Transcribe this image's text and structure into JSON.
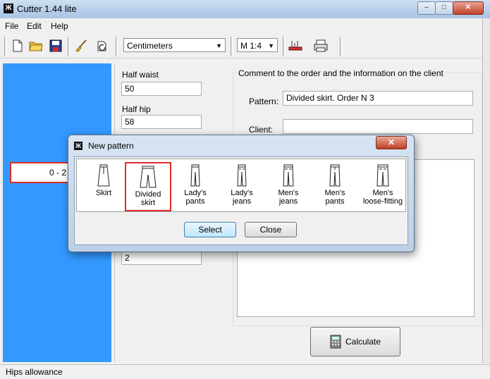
{
  "window": {
    "title": "Cutter 1.44 lite",
    "min": "–",
    "max": "□",
    "close": "✕"
  },
  "menu": [
    "File",
    "Edit",
    "Help"
  ],
  "toolbar": {
    "units": "Centimeters",
    "scale": "M 1:4"
  },
  "left_list": {
    "selected": "0 - 2"
  },
  "measurements": [
    {
      "label": "Half waist",
      "value": "50"
    },
    {
      "label": "Half hip",
      "value": "58"
    }
  ],
  "hidden_field_value": "2",
  "comment": {
    "legend": "Comment to the order and the information on the client",
    "pattern_label": "Pattern:",
    "pattern_value": "Divided skirt. Order N 3",
    "client_label": "Client:",
    "client_value": ""
  },
  "calculate_label": "Calculate",
  "status": "Hips allowance",
  "dialog": {
    "title": "New pattern",
    "close": "✕",
    "patterns": [
      {
        "line1": "Skirt",
        "line2": ""
      },
      {
        "line1": "Divided",
        "line2": "skirt"
      },
      {
        "line1": "Lady's",
        "line2": "pants"
      },
      {
        "line1": "Lady's",
        "line2": "jeans"
      },
      {
        "line1": "Men's",
        "line2": "jeans"
      },
      {
        "line1": "Men's",
        "line2": "pants"
      },
      {
        "line1": "Men's",
        "line2": "loose-fitting"
      }
    ],
    "selected_index": 1,
    "select_label": "Select",
    "close_label": "Close"
  },
  "colors": {
    "list_bg": "#3399ff",
    "selection_border": "#e32b2b"
  }
}
